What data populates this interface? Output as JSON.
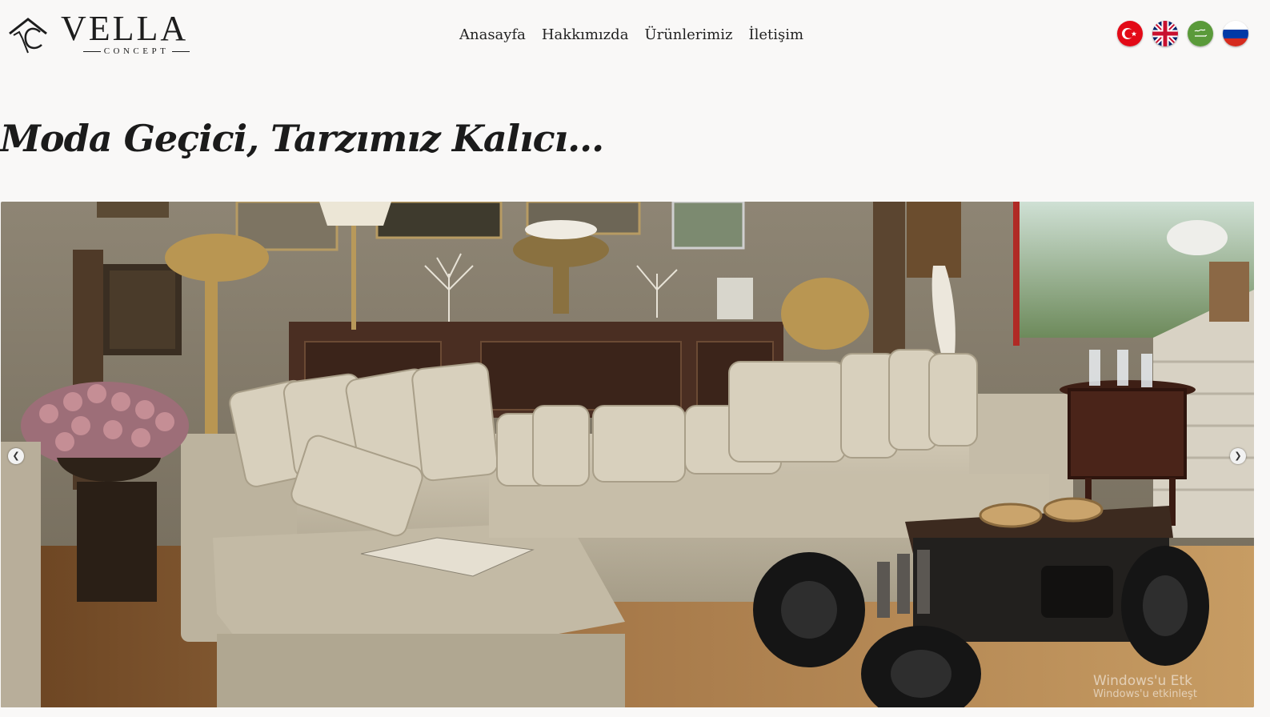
{
  "brand": {
    "name": "VELLA",
    "sub": "CONCEPT"
  },
  "nav": {
    "items": [
      {
        "label": "Anasayfa"
      },
      {
        "label": "Hakkımızda"
      },
      {
        "label": "Ürünlerimiz"
      },
      {
        "label": "İletişim"
      }
    ]
  },
  "languages": [
    {
      "icon": "turkey-flag-icon",
      "code": "tr"
    },
    {
      "icon": "uk-flag-icon",
      "code": "en"
    },
    {
      "icon": "saudi-flag-icon",
      "code": "ar"
    },
    {
      "icon": "russia-flag-icon",
      "code": "ru"
    }
  ],
  "hero": {
    "tagline": "Moda Geçici, Tarzımız Kalıcı...",
    "prev_icon": "chevron-left-icon",
    "next_icon": "chevron-right-icon",
    "prev_glyph": "❮",
    "next_glyph": "❯"
  },
  "watermark": {
    "line1": "Windows'u Etk",
    "line2": "Windows'u etkinleşt"
  },
  "colors": {
    "background": "#f9f8f7",
    "text": "#1b1b1b",
    "sofa": "#c9c0ac",
    "wall": "#8c8373"
  }
}
